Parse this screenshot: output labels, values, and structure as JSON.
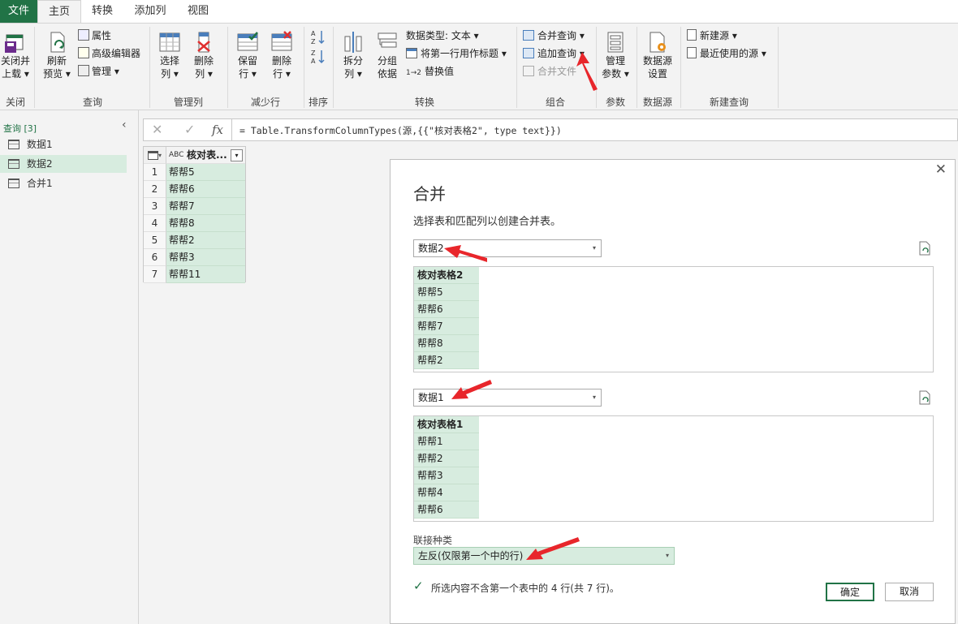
{
  "tabs": [
    "文件",
    "主页",
    "转换",
    "添加列",
    "视图"
  ],
  "ribbon": {
    "close_load": [
      "关闭并",
      "上载 ▾"
    ],
    "refresh": [
      "刷新",
      "预览 ▾"
    ],
    "properties": "属性",
    "advanced_editor": "高级编辑器",
    "manage": "管理 ▾",
    "choose_cols": [
      "选择",
      "列 ▾"
    ],
    "remove_cols": [
      "删除",
      "列 ▾"
    ],
    "keep_rows": [
      "保留",
      "行 ▾"
    ],
    "remove_rows": [
      "删除",
      "行 ▾"
    ],
    "split_col": [
      "拆分",
      "列 ▾"
    ],
    "group_by": [
      "分组",
      "依据"
    ],
    "data_type": "数据类型: 文本 ▾",
    "first_row_header": "将第一行用作标题 ▾",
    "replace_values": "替换值",
    "merge_queries": "合并查询 ▾",
    "append_queries": "追加查询 ▾",
    "combine_files": "合并文件",
    "manage_params": [
      "管理",
      "参数 ▾"
    ],
    "datasource_settings": [
      "数据源",
      "设置"
    ],
    "new_source": "新建源 ▾",
    "recent_sources": "最近使用的源 ▾",
    "groups": [
      "关闭",
      "查询",
      "管理列",
      "减少行",
      "排序",
      "转换",
      "组合",
      "参数",
      "数据源",
      "新建查询"
    ]
  },
  "queries": {
    "header": "查询 [3]",
    "items": [
      "数据1",
      "数据2",
      "合并1"
    ]
  },
  "formula": {
    "fx": "fx",
    "text": "= Table.TransformColumnTypes(源,{{\"核对表格2\", type text}})"
  },
  "grid": {
    "column": "核对表...",
    "type_icon": "ABC",
    "rows": [
      {
        "n": "1",
        "v": "帮帮5"
      },
      {
        "n": "2",
        "v": "帮帮6"
      },
      {
        "n": "3",
        "v": "帮帮7"
      },
      {
        "n": "4",
        "v": "帮帮8"
      },
      {
        "n": "5",
        "v": "帮帮2"
      },
      {
        "n": "6",
        "v": "帮帮3"
      },
      {
        "n": "7",
        "v": "帮帮11"
      }
    ]
  },
  "dialog": {
    "title": "合并",
    "subtitle": "选择表和匹配列以创建合并表。",
    "table1": "数据2",
    "preview1_header": "核对表格2",
    "preview1_rows": [
      "帮帮5",
      "帮帮6",
      "帮帮7",
      "帮帮8",
      "帮帮2"
    ],
    "table2": "数据1",
    "preview2_header": "核对表格1",
    "preview2_rows": [
      "帮帮1",
      "帮帮2",
      "帮帮3",
      "帮帮4",
      "帮帮6"
    ],
    "join_label": "联接种类",
    "join_kind": "左反(仅限第一个中的行)",
    "status": "所选内容不含第一个表中的 4 行(共 7 行)。",
    "ok": "确定",
    "cancel": "取消"
  },
  "colors": {
    "accent": "#217346",
    "selection": "#d7ecdf",
    "arrow": "#e8262b"
  }
}
